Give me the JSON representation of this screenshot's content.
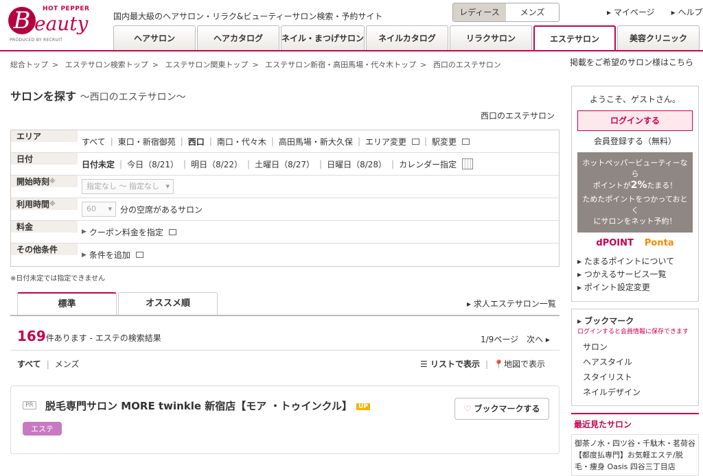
{
  "header": {
    "logo_top": "HOT PEPPER",
    "logo_b": "B",
    "logo_rest": "eauty",
    "logo_produced": "PRODUCED BY RECRUIT",
    "tagline": "国内最大級のヘアサロン・リラク&ビューティーサロン検索・予約サイト",
    "gender": [
      "レディース",
      "メンズ"
    ],
    "mypage": "マイページ",
    "help": "ヘルプ",
    "tabs": [
      "ヘアサロン",
      "ヘアカタログ",
      "ネイル・まつげサロン",
      "ネイルカタログ",
      "リラクサロン",
      "エステサロン",
      "美容クリニック"
    ]
  },
  "breadcrumbs": [
    "総合トップ",
    "エステサロン検索トップ",
    "エステサロン関東トップ",
    "エステサロン新宿・高田馬場・代々木トップ",
    "西口のエステサロン"
  ],
  "advert_link": "掲載をご希望のサロン様はこちら",
  "page": {
    "title": "サロンを探す",
    "subtitle": "～西口のエステサロン～",
    "area_label": "西口のエステサロン"
  },
  "search": {
    "area": {
      "label": "エリア",
      "options": [
        "すべて",
        "東口・新宿御苑",
        "西口",
        "南口・代々木",
        "高田馬場・新大久保"
      ],
      "change_area": "エリア変更",
      "change_station": "駅変更"
    },
    "date": {
      "label": "日付",
      "options": [
        "日付未定",
        "今日（8/21）",
        "明日（8/22）",
        "土曜日（8/27）",
        "日曜日（8/28）"
      ],
      "calendar": "カレンダー指定"
    },
    "start_time": {
      "label": "開始時刻",
      "value": "指定なし ～ 指定なし"
    },
    "usage_time": {
      "label": "利用時間",
      "value": "60",
      "suffix": "分の空席があるサロン"
    },
    "price": {
      "label": "料金",
      "link": "クーポン料金を指定"
    },
    "other": {
      "label": "その他条件",
      "link": "条件を追加"
    },
    "asterisk": "※",
    "note": "※日付未定では指定できません"
  },
  "results": {
    "tabs": [
      "標準",
      "オススメ順"
    ],
    "recruit_link": "求人エステサロン一覧",
    "count": "169",
    "count_text": "件あります - エステの検索結果",
    "page": "1/9ページ",
    "next": "次へ",
    "filter_all": "すべて",
    "filter_mens": "メンズ",
    "list_view": "リストで表示",
    "map_view": "地図で表示"
  },
  "salon": {
    "pr": "PR",
    "name": "脱毛専門サロン MORE twinkle 新宿店【モア ・トゥインクル】",
    "up": "UP",
    "tag": "エステ",
    "bookmark": "ブックマークする"
  },
  "sidebar": {
    "welcome": "ようこそ、ゲストさん。",
    "login": "ログインする",
    "register": "会員登録する（無料）",
    "point_line1": "ホットペッパービューティーなら",
    "point_line2a": "ポイントが",
    "point_pct": "2%",
    "point_line2b": "たまる！",
    "point_line3": "ためたポイントをつかっておとく",
    "point_line4": "にサロンをネット予約！",
    "dpoint": "dPOINT",
    "ponta": "Ponta",
    "links": [
      "たまるポイントについて",
      "つかえるサービス一覧",
      "ポイント設定変更"
    ],
    "bookmark_title": "ブックマーク",
    "bookmark_note": "ログインすると会員情報に保存できます",
    "bookmark_items": [
      "サロン",
      "ヘアスタイル",
      "スタイリスト",
      "ネイルデザイン"
    ],
    "recent_title": "最近見たサロン",
    "recent_item": "御茶ノ水・四ツ谷・千駄木・茗荷谷【都度払専門】お気軽エステ/脱毛・痩身 Oasis 四谷三丁目店"
  },
  "colors": {
    "accent": "#c8004b",
    "tag": "#c77ac2",
    "up": "#f3b300"
  }
}
